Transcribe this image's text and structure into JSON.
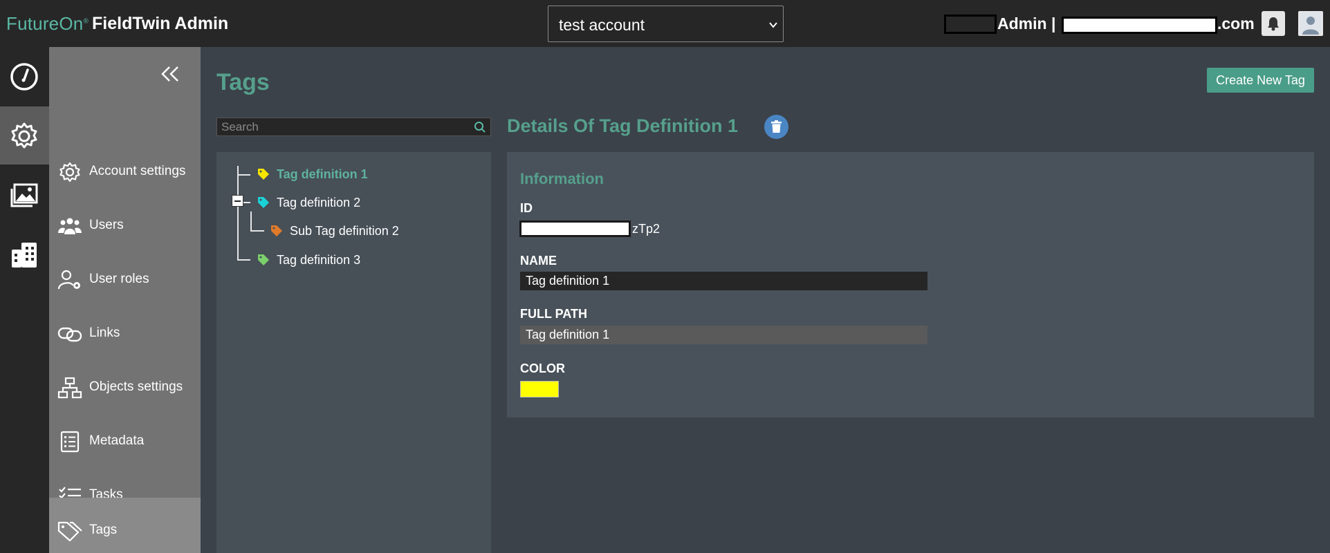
{
  "header": {
    "brand": "FutureOn",
    "brand_mark": "®",
    "app_title": "FieldTwin Admin",
    "account_selected": "test account",
    "user_role": "Admin |",
    "user_domain": ".com"
  },
  "rail": {
    "items": [
      {
        "name": "dashboard",
        "icon": "gauge-icon"
      },
      {
        "name": "settings",
        "icon": "gear-icon",
        "active": true
      },
      {
        "name": "gallery",
        "icon": "images-icon"
      },
      {
        "name": "buildings",
        "icon": "building-icon"
      }
    ]
  },
  "sidebar": {
    "items": [
      {
        "label": "Account settings",
        "icon": "gear-icon"
      },
      {
        "label": "Users",
        "icon": "users-icon"
      },
      {
        "label": "User roles",
        "icon": "user-roles-icon"
      },
      {
        "label": "Links",
        "icon": "link-icon"
      },
      {
        "label": "Objects settings",
        "icon": "hierarchy-icon"
      },
      {
        "label": "Metadata",
        "icon": "list-icon"
      },
      {
        "label": "Tasks",
        "icon": "tasks-icon"
      },
      {
        "label": "Tags",
        "icon": "tags-icon",
        "active": true
      }
    ]
  },
  "main": {
    "title": "Tags",
    "create_button": "Create New Tag",
    "search_placeholder": "Search",
    "tree": [
      {
        "label": "Tag definition 1",
        "color": "#f5e500",
        "selected": true
      },
      {
        "label": "Tag definition 2",
        "color": "#19d3d8"
      },
      {
        "label": "Sub Tag definition 2",
        "color": "#e07b2a"
      },
      {
        "label": "Tag definition 3",
        "color": "#7bd06b"
      }
    ]
  },
  "details": {
    "title": "Details Of Tag Definition 1",
    "section_title": "Information",
    "id_label": "ID",
    "id_visible_suffix": "zTp2",
    "name_label": "NAME",
    "name_value": "Tag definition 1",
    "path_label": "FULL PATH",
    "path_value": "Tag definition 1",
    "color_label": "COLOR",
    "color_value": "#ffff00"
  }
}
